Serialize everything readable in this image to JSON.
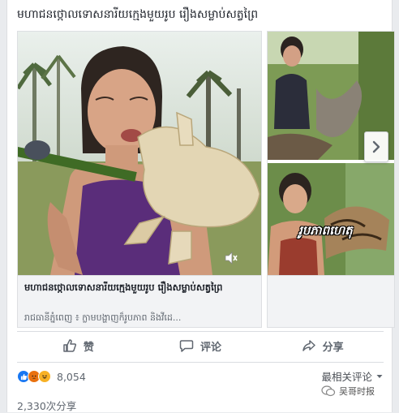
{
  "post": {
    "text": "មហាជនថ្កោលទោសនារីយក្មេងមួយរូប រឿងសម្លាប់សត្វព្រៃ"
  },
  "carousel": {
    "cards": [
      {
        "title": "មហាជនថ្កោលទោសនារីយក្មេងមួយរូប រឿងសម្លាប់សត្វព្រៃ",
        "source": "រាជធានីភ្នំពេញ ៖ ក្លាមបង្ហាញក៏រូបភាព និងវីដេ..."
      },
      {
        "overlay_caption": "រូបភាពហេតុ"
      }
    ],
    "next_icon": "chevron-right-icon"
  },
  "actions": {
    "like_label": "赞",
    "comment_label": "评论",
    "share_label": "分享"
  },
  "reactions": {
    "count": "8,054",
    "icons": [
      "like-icon",
      "angry-icon",
      "haha-icon"
    ]
  },
  "sort": {
    "label": "最相关评论"
  },
  "shares": {
    "text": "2,330次分享"
  },
  "watermark": {
    "text": "吴哥时报"
  },
  "colors": {
    "like_blue": "#1877f2",
    "angry_orange": "#e9710f",
    "haha_yellow": "#f7b125",
    "text_secondary": "#606770"
  }
}
